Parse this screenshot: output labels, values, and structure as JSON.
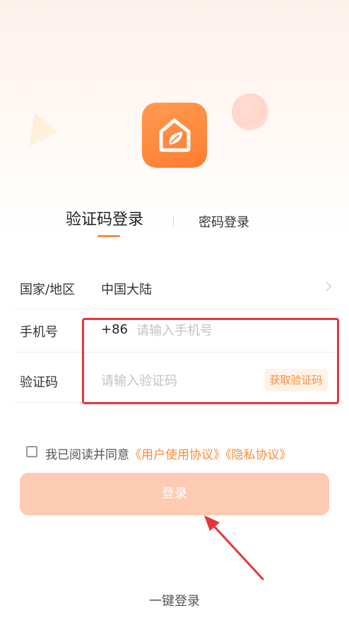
{
  "brand": {
    "accent_color": "#ff8a3d",
    "logo_icon": "house-leaf-icon"
  },
  "tabs": {
    "code_login": "验证码登录",
    "password_login": "密码登录"
  },
  "form": {
    "region_label": "国家/地区",
    "region_value": "中国大陆",
    "phone_label": "手机号",
    "phone_prefix": "+86",
    "phone_placeholder": "请输入手机号",
    "code_label": "验证码",
    "code_placeholder": "请输入验证码",
    "get_code_button": "获取验证码"
  },
  "agreement": {
    "prefix_text": "我已阅读并同意",
    "user_agreement": "《用户使用协议》",
    "privacy_agreement": "《隐私协议》",
    "checked": false
  },
  "login_button": "登录",
  "one_click_login": "一键登录",
  "annotation": {
    "highlight_color": "#e8343a",
    "arrow_color": "#e8343a"
  }
}
